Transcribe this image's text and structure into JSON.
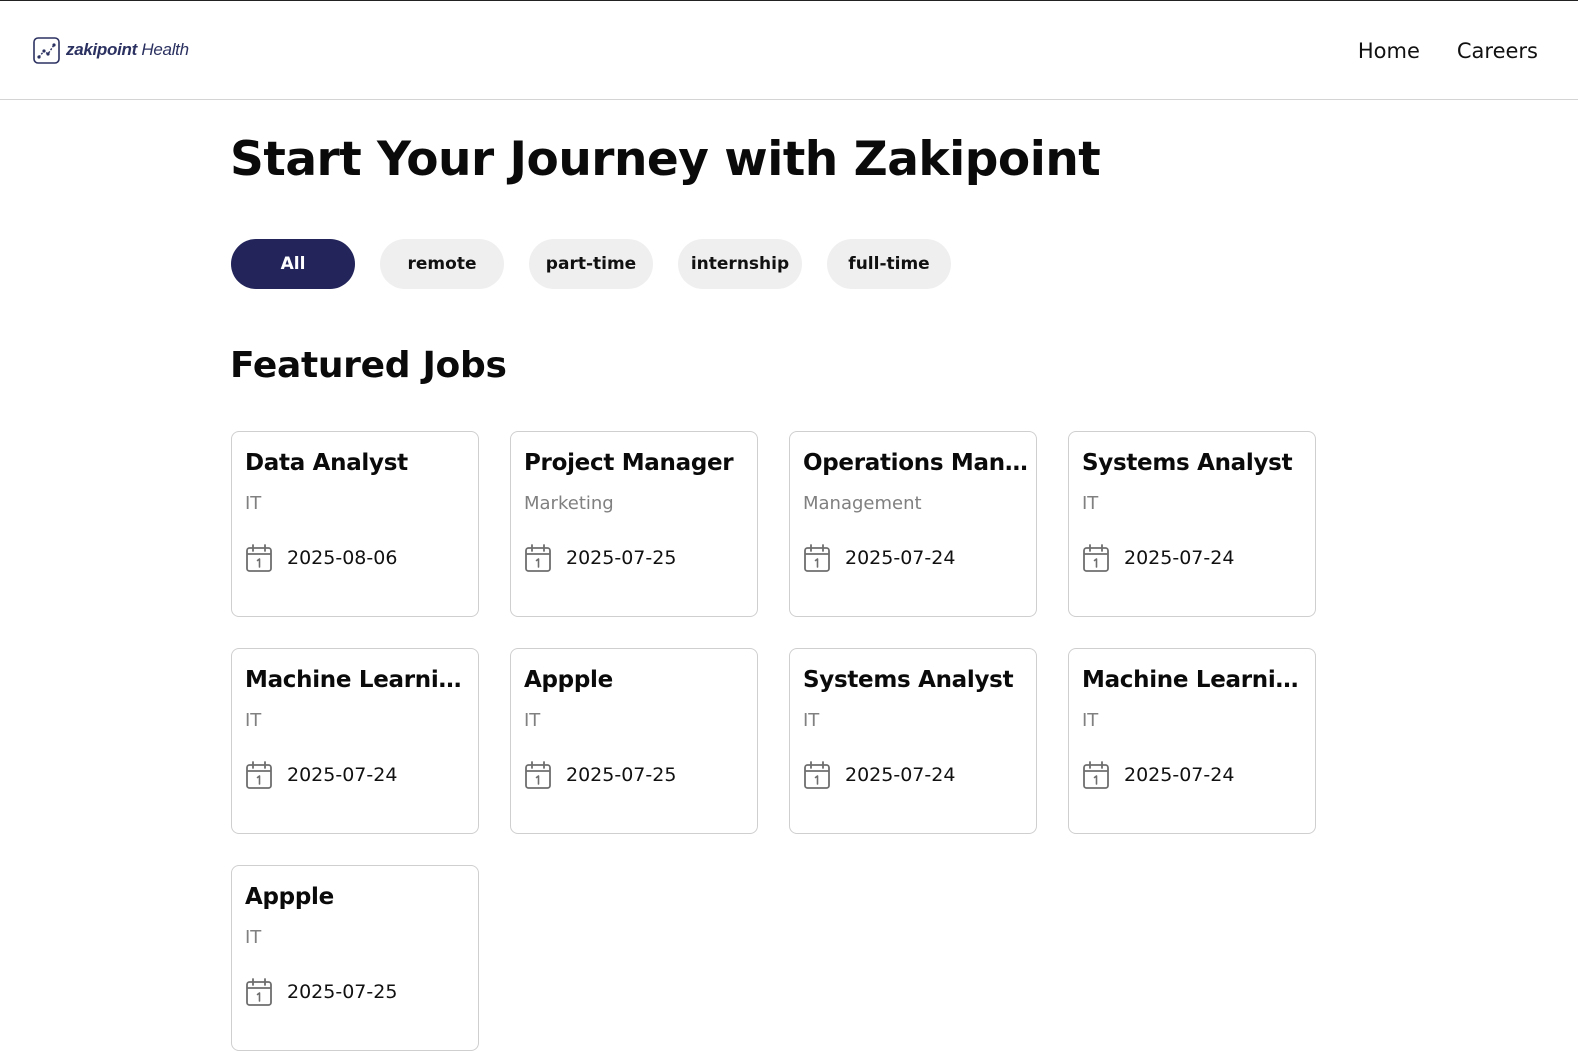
{
  "header": {
    "logo": {
      "brand": "zakipoint",
      "suffix": " Health",
      "icon": "chart-logo-icon"
    },
    "nav": [
      {
        "label": "Home"
      },
      {
        "label": "Careers"
      }
    ]
  },
  "hero": {
    "title": "Start Your Journey with Zakipoint"
  },
  "filters": {
    "active": "All",
    "items": [
      {
        "label": "All"
      },
      {
        "label": "remote"
      },
      {
        "label": "part-time"
      },
      {
        "label": "internship"
      },
      {
        "label": "full-time"
      }
    ]
  },
  "featured": {
    "title": "Featured Jobs",
    "date_icon": "calendar-icon",
    "jobs": [
      {
        "title": "Data Analyst",
        "department": "IT",
        "date": "2025-08-06"
      },
      {
        "title": "Project Manager",
        "department": "Marketing",
        "date": "2025-07-25"
      },
      {
        "title": "Operations Manager",
        "department": "Management",
        "date": "2025-07-24"
      },
      {
        "title": "Systems Analyst",
        "department": "IT",
        "date": "2025-07-24"
      },
      {
        "title": "Machine Learning Engineer",
        "department": "IT",
        "date": "2025-07-24"
      },
      {
        "title": "Appple",
        "department": "IT",
        "date": "2025-07-25"
      },
      {
        "title": "Systems Analyst",
        "department": "IT",
        "date": "2025-07-24"
      },
      {
        "title": "Machine Learning Engineer",
        "department": "IT",
        "date": "2025-07-24"
      },
      {
        "title": "Appple",
        "department": "IT",
        "date": "2025-07-25"
      }
    ]
  },
  "colors": {
    "accent": "#22245a",
    "chip_bg": "#efefef",
    "muted_text": "#808080",
    "border": "#cfcfcf",
    "logo": "#2b3160"
  }
}
